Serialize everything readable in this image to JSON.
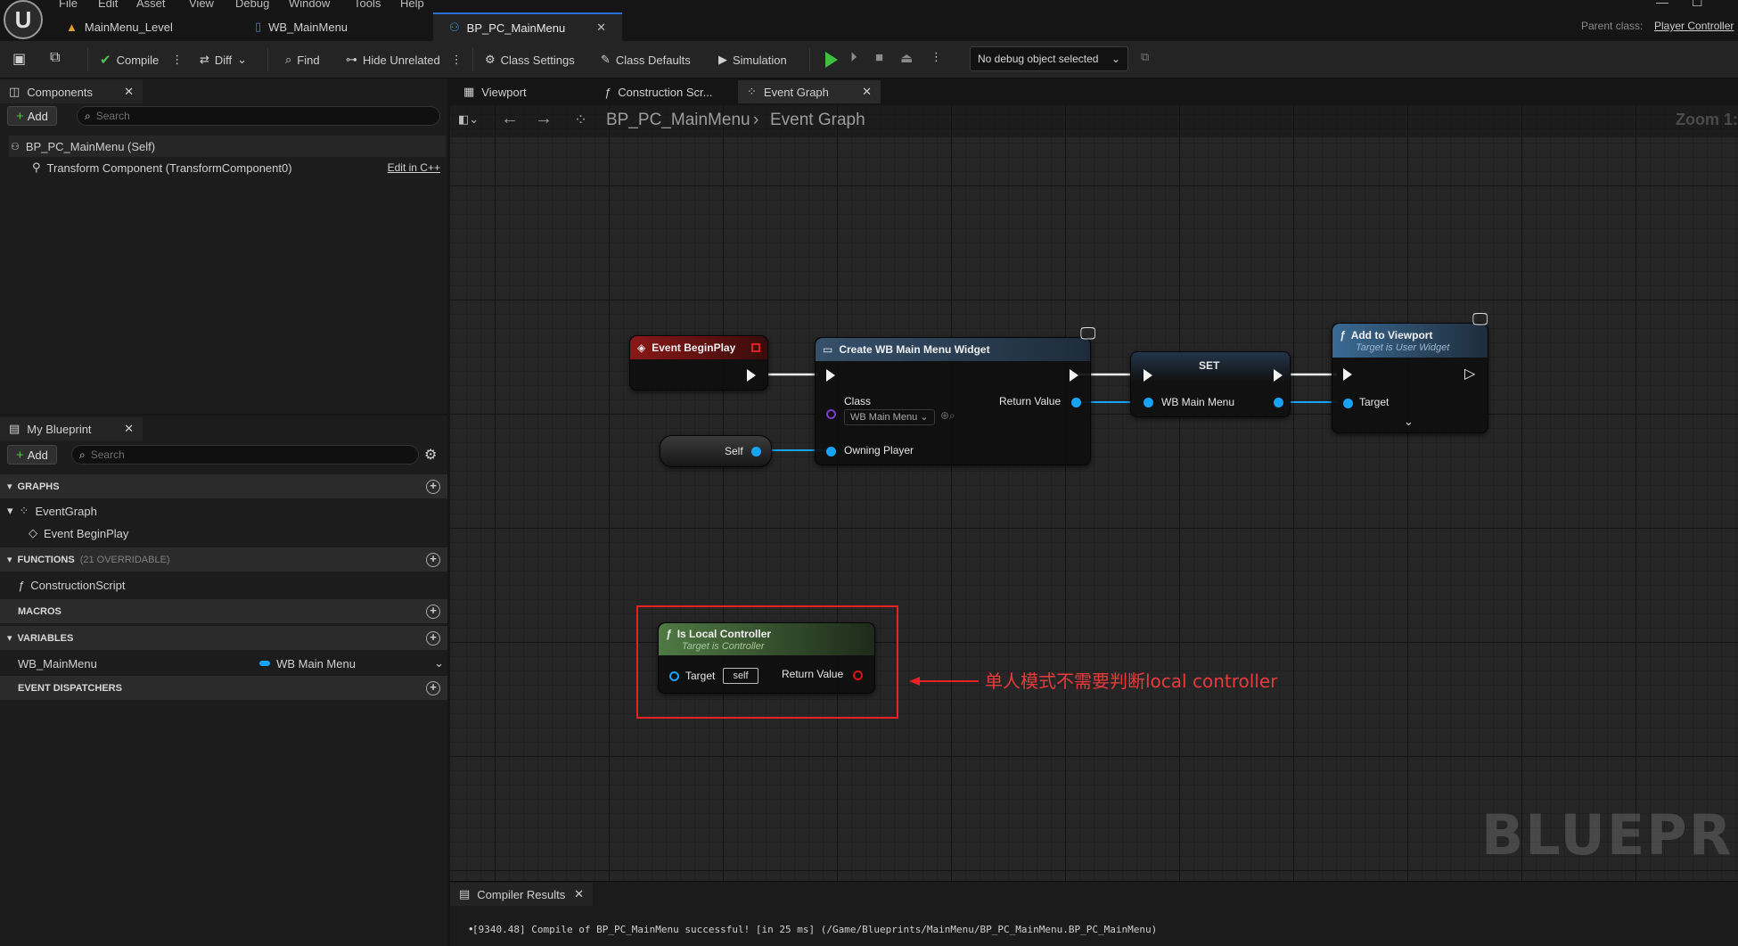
{
  "menu": [
    "File",
    "Edit",
    "Asset",
    "View",
    "Debug",
    "Window",
    "Tools",
    "Help"
  ],
  "doc_tabs": [
    {
      "label": "MainMenu_Level"
    },
    {
      "label": "WB_MainMenu"
    },
    {
      "label": "BP_PC_MainMenu"
    }
  ],
  "parent_class": {
    "label": "Parent class:",
    "value": "Player Controller"
  },
  "toolbar": {
    "compile": "Compile",
    "diff": "Diff",
    "find": "Find",
    "hide_unrelated": "Hide Unrelated",
    "class_settings": "Class Settings",
    "class_defaults": "Class Defaults",
    "simulation": "Simulation",
    "debug_object": "No debug object selected"
  },
  "components_panel": {
    "tab": "Components",
    "add": "Add",
    "search_placeholder": "Search",
    "root": "BP_PC_MainMenu (Self)",
    "child": "Transform Component (TransformComponent0)",
    "edit_link": "Edit in C++"
  },
  "my_blueprint": {
    "tab": "My Blueprint",
    "add": "Add",
    "search_placeholder": "Search",
    "graphs_header": "GRAPHS",
    "event_graph": "EventGraph",
    "event_begin_play": "Event BeginPlay",
    "functions_header": "FUNCTIONS",
    "functions_count": "(21 OVERRIDABLE)",
    "construction_script": "ConstructionScript",
    "macros_header": "MACROS",
    "variables_header": "VARIABLES",
    "variable_name": "WB_MainMenu",
    "variable_type": "WB Main Menu",
    "dispatchers_header": "EVENT DISPATCHERS"
  },
  "graph_tabs": [
    "Viewport",
    "Construction Scr...",
    "Event Graph"
  ],
  "breadcrumb": {
    "blueprint": "BP_PC_MainMenu",
    "graph": "Event Graph"
  },
  "zoom": "Zoom 1:",
  "nodes": {
    "begin_play": "Event BeginPlay",
    "create_widget": {
      "title": "Create WB Main Menu Widget",
      "class": "Class",
      "class_value": "WB Main Menu",
      "return_value": "Return Value",
      "owning_player": "Owning Player"
    },
    "self_node": "Self",
    "set_node": {
      "title": "SET",
      "pin": "WB Main Menu"
    },
    "add_to_viewport": {
      "title": "Add to Viewport",
      "subtitle": "Target is User Widget",
      "target": "Target"
    },
    "is_local_controller": {
      "title": "Is Local Controller",
      "subtitle": "Target is Controller",
      "target": "Target",
      "target_default": "self",
      "return_value": "Return Value"
    }
  },
  "annotation": "单人模式不需要判断local controller",
  "watermark": "BLUEPRINT",
  "compiler": {
    "tab": "Compiler Results",
    "message": "[9340.48] Compile of BP_PC_MainMenu successful! [in 25 ms] (/Game/Blueprints/MainMenu/BP_PC_MainMenu.BP_PC_MainMenu)"
  },
  "colors": {
    "accent_blue": "#2a6fd6",
    "event_header": "#7a1414",
    "function_header": "#2e4a66",
    "pure_function_header": "#3d5c35",
    "annotation_red": "#e82222",
    "data_pin_blue": "#19a3f5",
    "play_green": "#3fbf3f"
  }
}
